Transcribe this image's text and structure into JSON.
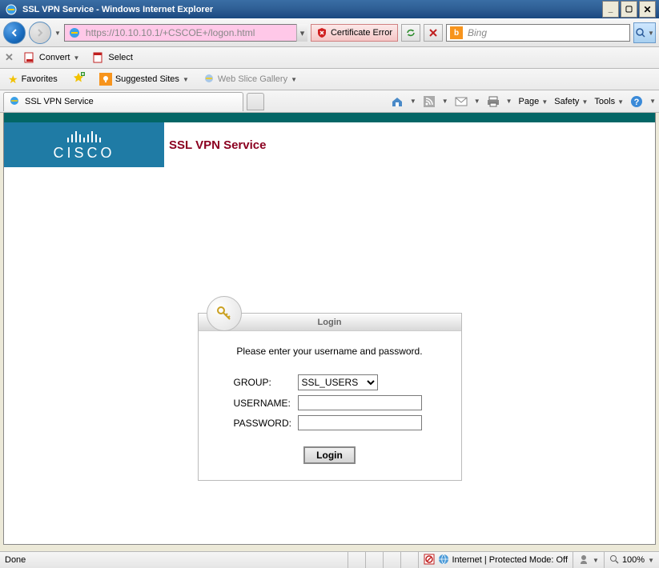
{
  "window": {
    "title": "SSL VPN Service - Windows Internet Explorer"
  },
  "navbar": {
    "url": "https://10.10.10.1/+CSCOE+/logon.html",
    "cert_error": "Certificate Error",
    "search_placeholder": "Bing"
  },
  "toolbar_convert": {
    "convert": "Convert",
    "select": "Select"
  },
  "favbar": {
    "favorites": "Favorites",
    "suggested": "Suggested Sites",
    "webslice": "Web Slice Gallery"
  },
  "tabs": {
    "tab1": "SSL VPN Service"
  },
  "tabmenu": {
    "page": "Page",
    "safety": "Safety",
    "tools": "Tools"
  },
  "page": {
    "service_title": "SSL VPN Service",
    "cisco": "CISCO"
  },
  "login": {
    "header": "Login",
    "message": "Please enter your username and password.",
    "group_label": "GROUP:",
    "group_value": "SSL_USERS",
    "username_label": "USERNAME:",
    "password_label": "PASSWORD:",
    "button": "Login"
  },
  "status": {
    "done": "Done",
    "zone": "Internet | Protected Mode: Off",
    "zoom": "100%"
  }
}
